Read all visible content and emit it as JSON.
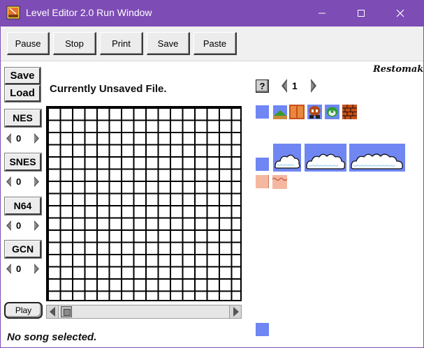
{
  "window": {
    "title": "Level Editor 2.0 Run Window"
  },
  "toolbar": {
    "pause_label": "Pause",
    "stop_label": "Stop",
    "print_label": "Print",
    "save_label": "Save",
    "paste_label": "Paste"
  },
  "file": {
    "save_label": "Save",
    "load_label": "Load",
    "status": "Currently Unsaved File."
  },
  "systems": [
    {
      "label": "NES",
      "count": "0"
    },
    {
      "label": "SNES",
      "count": "0"
    },
    {
      "label": "N64",
      "count": "0"
    },
    {
      "label": "GCN",
      "count": "0"
    }
  ],
  "player": {
    "play_label": "Play",
    "song_status": "No song selected."
  },
  "palette": {
    "help_label": "?",
    "page_number": "1",
    "logo_text": "Restomak"
  },
  "colors": {
    "titlebar": "#7d4cb5",
    "sky_tile": "#6f86f3",
    "brick": "#c8501c"
  }
}
